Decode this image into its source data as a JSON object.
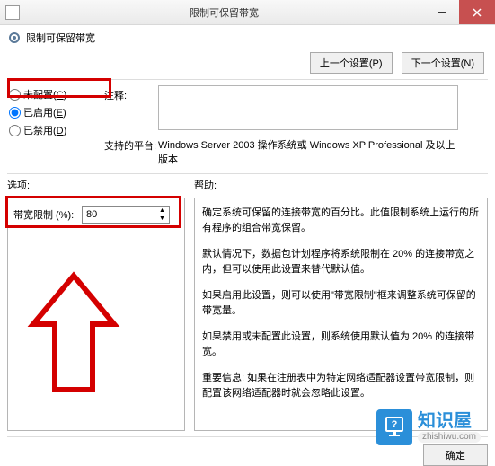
{
  "title": "限制可保留带宽",
  "subtitle": "限制可保留带宽",
  "nav": {
    "prev": "上一个设置(P)",
    "next": "下一个设置(N)"
  },
  "radios": {
    "none_pre": "未配置(",
    "none_u": "C",
    "none_post": ")",
    "enabled_pre": "已启用(",
    "enabled_u": "E",
    "enabled_post": ")",
    "disabled_pre": "已禁用(",
    "disabled_u": "D",
    "disabled_post": ")"
  },
  "labels": {
    "comment": "注释:",
    "platform": "支持的平台:",
    "options": "选项:",
    "help": "帮助:",
    "band": "带宽限制 (%):"
  },
  "platform_text": "Windows Server 2003 操作系统或 Windows XP Professional 及以上版本",
  "band_value": "80",
  "help": {
    "p1": "确定系统可保留的连接带宽的百分比。此值限制系统上运行的所有程序的组合带宽保留。",
    "p2": "默认情况下，数据包计划程序将系统限制在 20% 的连接带宽之内，但可以使用此设置来替代默认值。",
    "p3": "如果启用此设置，则可以使用\"带宽限制\"框来调整系统可保留的带宽量。",
    "p4": "如果禁用或未配置此设置，则系统使用默认值为 20% 的连接带宽。",
    "p5": "重要信息: 如果在注册表中为特定网络适配器设置带宽限制，则配置该网络适配器时就会忽略此设置。"
  },
  "bottom_btn": "确定",
  "logo": {
    "cn": "知识屋",
    "en": "zhishiwu.com"
  }
}
